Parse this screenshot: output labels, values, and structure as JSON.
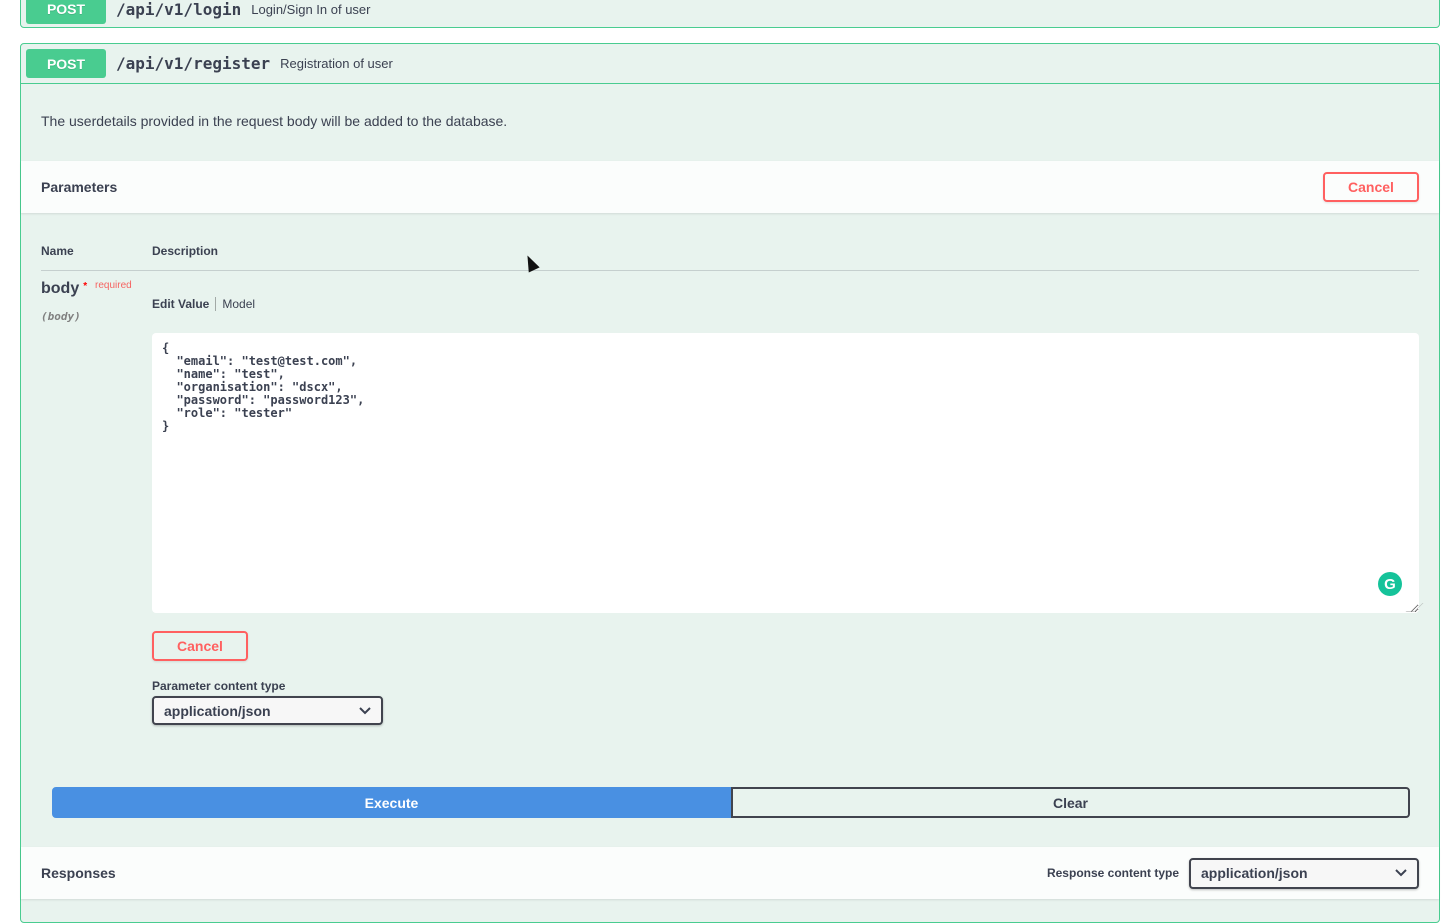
{
  "login": {
    "method": "POST",
    "path": "/api/v1/login",
    "summary": "Login/Sign In of user"
  },
  "register": {
    "method": "POST",
    "path": "/api/v1/register",
    "summary": "Registration of user",
    "description": "The userdetails provided in the request body will be added to the database."
  },
  "parameters": {
    "title": "Parameters",
    "cancel_label": "Cancel",
    "col_name": "Name",
    "col_description": "Description",
    "param_name": "body",
    "required_star": "*",
    "required_label": "required",
    "param_in": "(body)",
    "tab_edit": "Edit Value",
    "tab_model": "Model",
    "body_value": "{\n  \"email\": \"test@test.com\",\n  \"name\": \"test\",\n  \"organisation\": \"dscx\",\n  \"password\": \"password123\",\n  \"role\": \"tester\"\n}",
    "body_cancel_label": "Cancel",
    "content_type_label": "Parameter content type",
    "content_type_value": "application/json"
  },
  "actions": {
    "execute_label": "Execute",
    "clear_label": "Clear"
  },
  "responses": {
    "title": "Responses",
    "content_type_label": "Response content type",
    "content_type_value": "application/json"
  },
  "icons": {
    "chevron": "chevron-down-icon",
    "grammarly": "grammarly-icon"
  },
  "colors": {
    "post_green": "#49cc90",
    "execute_blue": "#4990e2",
    "cancel_red": "#ff6060"
  }
}
